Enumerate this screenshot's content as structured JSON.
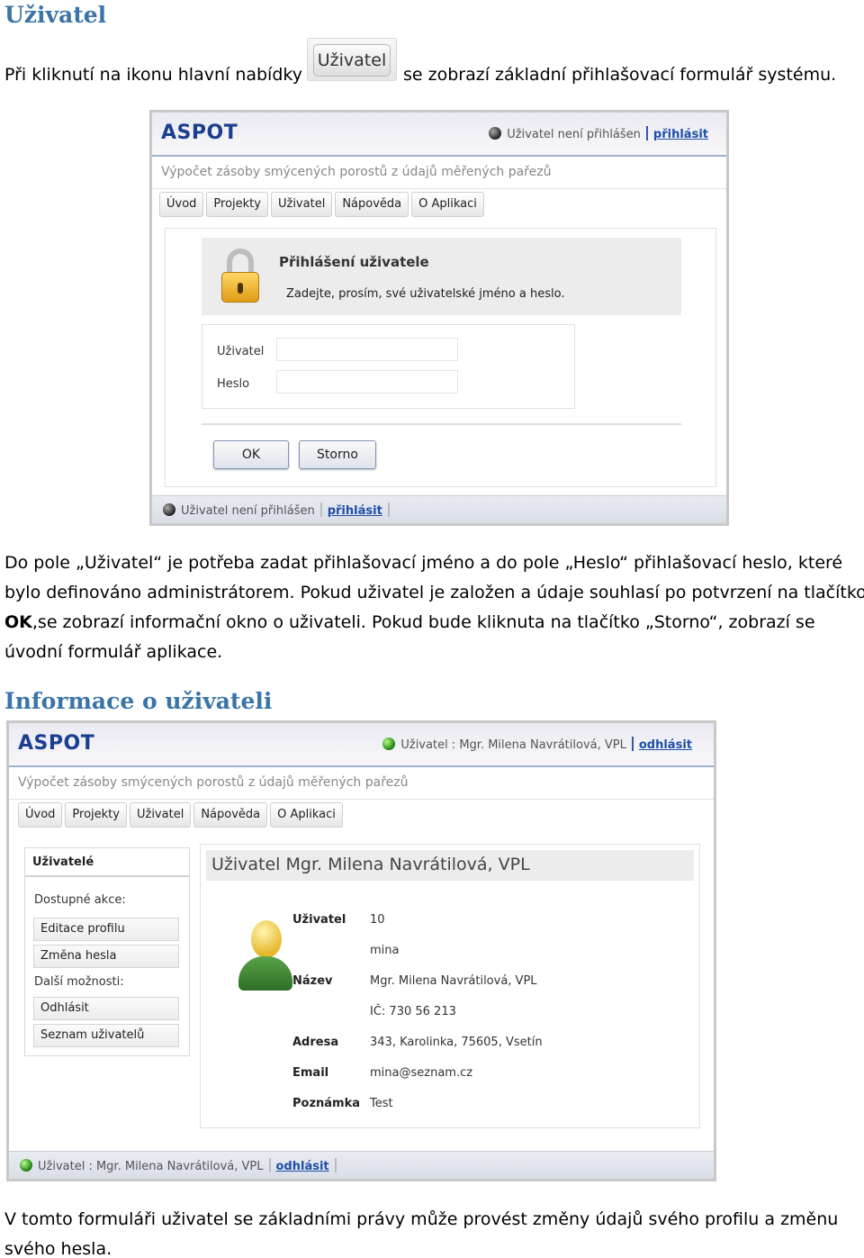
{
  "heading1": "Uživatel",
  "para1": {
    "before": "Při kliknutí na ikonu hlavní nabídky",
    "icon_label": "Uživatel",
    "after": "se zobrazí základní přihlašovací formulář systému."
  },
  "app": {
    "logo": "ASPOT",
    "subtitle": "Výpočet zásoby smýcených porostů z údajů měřených pařezů",
    "menu": [
      "Úvod",
      "Projekty",
      "Uživatel",
      "Nápověda",
      "O Aplikaci"
    ]
  },
  "login": {
    "status_text": "Uživatel není přihlášen",
    "status_link": "přihlásit",
    "title": "Přihlášení uživatele",
    "hint": "Zadejte, prosím, své uživatelské jméno a heslo.",
    "user_label": "Uživatel",
    "password_label": "Heslo",
    "user_value": "",
    "password_value": "",
    "ok": "OK",
    "cancel": "Storno"
  },
  "para2": {
    "line1": "Do pole „Uživatel“ je potřeba zadat přihlašovací jméno a do pole „Heslo“ přihlašovací heslo, které",
    "line2": "bylo definováno administrátorem. Pokud uživatel je založen a údaje souhlasí po potvrzení na tlačítko",
    "line3_bold": "OK",
    "line3_rest": ",se zobrazí informační okno o uživateli. Pokud bude kliknuta na tlačítko „Storno“, zobrazí se",
    "line4": "úvodní formulář aplikace."
  },
  "heading2": "Informace o uživateli",
  "info": {
    "status_text": "Uživatel : Mgr. Milena Navrátilová, VPL",
    "status_link": "odhlásit",
    "sidebar": {
      "title": "Uživatelé",
      "available": "Dostupné akce:",
      "actions1": [
        "Editace profilu",
        "Změna hesla"
      ],
      "more": "Další možnosti:",
      "actions2": [
        "Odhlásit",
        "Seznam uživatelů"
      ]
    },
    "panel_title": "Uživatel Mgr. Milena Navrátilová, VPL",
    "rows": [
      {
        "label": "Uživatel",
        "value": "10"
      },
      {
        "label": "",
        "value": "mina"
      },
      {
        "label": "Název",
        "value": "Mgr. Milena Navrátilová, VPL"
      },
      {
        "label": "",
        "value": "IČ: 730 56 213"
      },
      {
        "label": "Adresa",
        "value": "343, Karolinka, 75605, Vsetín"
      },
      {
        "label": "Email",
        "value": "mina@seznam.cz"
      },
      {
        "label": "Poznámka",
        "value": "Test"
      }
    ]
  },
  "para3": {
    "line1": "V tomto formuláři uživatel se základními právy může provést změny údajů svého profilu a změnu",
    "line2": "svého hesla."
  }
}
